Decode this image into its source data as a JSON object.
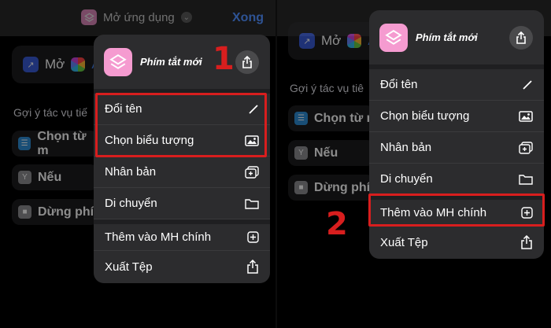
{
  "left": {
    "topbar": {
      "title": "Mở ứng dụng",
      "done": "Xong"
    },
    "action": {
      "text": "Mở",
      "partial": "A"
    },
    "suggestions_label": "Gợi ý tác vụ tiế",
    "suggestions": [
      "Chọn từ m",
      "Nếu",
      "Dừng phí"
    ],
    "menu": {
      "title": "Phím tắt mới",
      "items": [
        "Đổi tên",
        "Chọn biểu tượng",
        "Nhân bản",
        "Di chuyển",
        "Thêm vào MH chính",
        "Xuất Tệp"
      ]
    },
    "step": "1"
  },
  "right": {
    "action": {
      "text": "Mở",
      "partial": "A"
    },
    "suggestions_label": "Gợi ý tác vụ tiê",
    "suggestions": [
      "Chọn từ n",
      "Nếu",
      "Dừng phí"
    ],
    "menu": {
      "title": "Phím tắt mới",
      "items": [
        "Đổi tên",
        "Chọn biểu tượng",
        "Nhân bản",
        "Di chuyển",
        "Thêm vào MH chính",
        "Xuất Tệp"
      ]
    },
    "step": "2"
  },
  "colors": {
    "accent_blue": "#3f7ce8",
    "highlight_red": "#d81e1e",
    "shortcut_pink": "#f59bd0"
  },
  "icons": [
    "shortcuts-icon",
    "share-icon",
    "pencil-icon",
    "photo-icon",
    "duplicate-icon",
    "folder-icon",
    "plus-square-icon",
    "export-icon"
  ]
}
